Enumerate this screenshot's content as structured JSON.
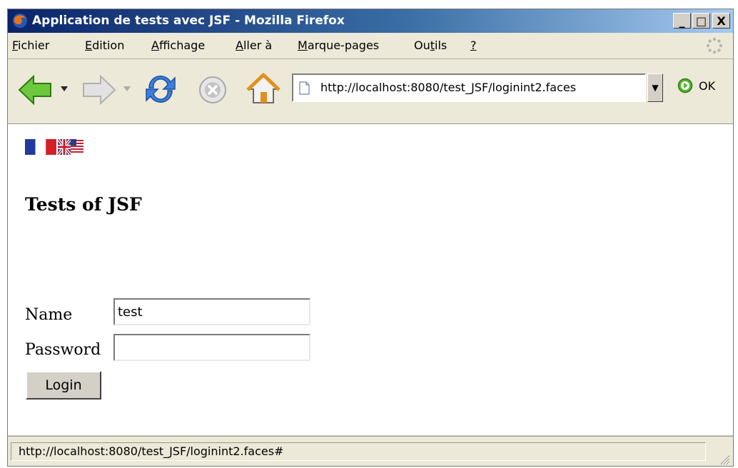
{
  "window": {
    "title": "Application de tests avec JSF - Mozilla Firefox",
    "controls": {
      "minimize": "_",
      "maximize": "□",
      "close": "X"
    }
  },
  "menu": {
    "items": [
      {
        "first": "F",
        "rest": "ichier"
      },
      {
        "first": "E",
        "rest": "dition"
      },
      {
        "first": "A",
        "rest": "ffichage"
      },
      {
        "first": "A",
        "rest": "ller à"
      },
      {
        "first": "M",
        "rest": "arque-pages"
      },
      {
        "pre": "Ou",
        "first": "t",
        "rest": "ils"
      },
      {
        "first": "?",
        "rest": ""
      }
    ]
  },
  "toolbar": {
    "icons": [
      "back-icon",
      "forward-icon",
      "reload-icon",
      "stop-icon",
      "home-icon"
    ],
    "url": "http://localhost:8080/test_JSF/loginint2.faces",
    "go_label": "OK"
  },
  "page": {
    "flags": [
      "french-flag-icon",
      "uk-flag-icon"
    ],
    "heading": "Tests of JSF",
    "form": {
      "name_label": "Name",
      "name_value": "test",
      "password_label": "Password",
      "password_value": "",
      "login_label": "Login"
    }
  },
  "status": {
    "text": "http://localhost:8080/test_JSF/loginint2.faces#"
  },
  "colors": {
    "titlebar_start": "#0a246a",
    "titlebar_end": "#a6caf0",
    "chrome": "#ece9d8",
    "reload_blue": "#2f6fd6",
    "back_green": "#4caf2a"
  }
}
